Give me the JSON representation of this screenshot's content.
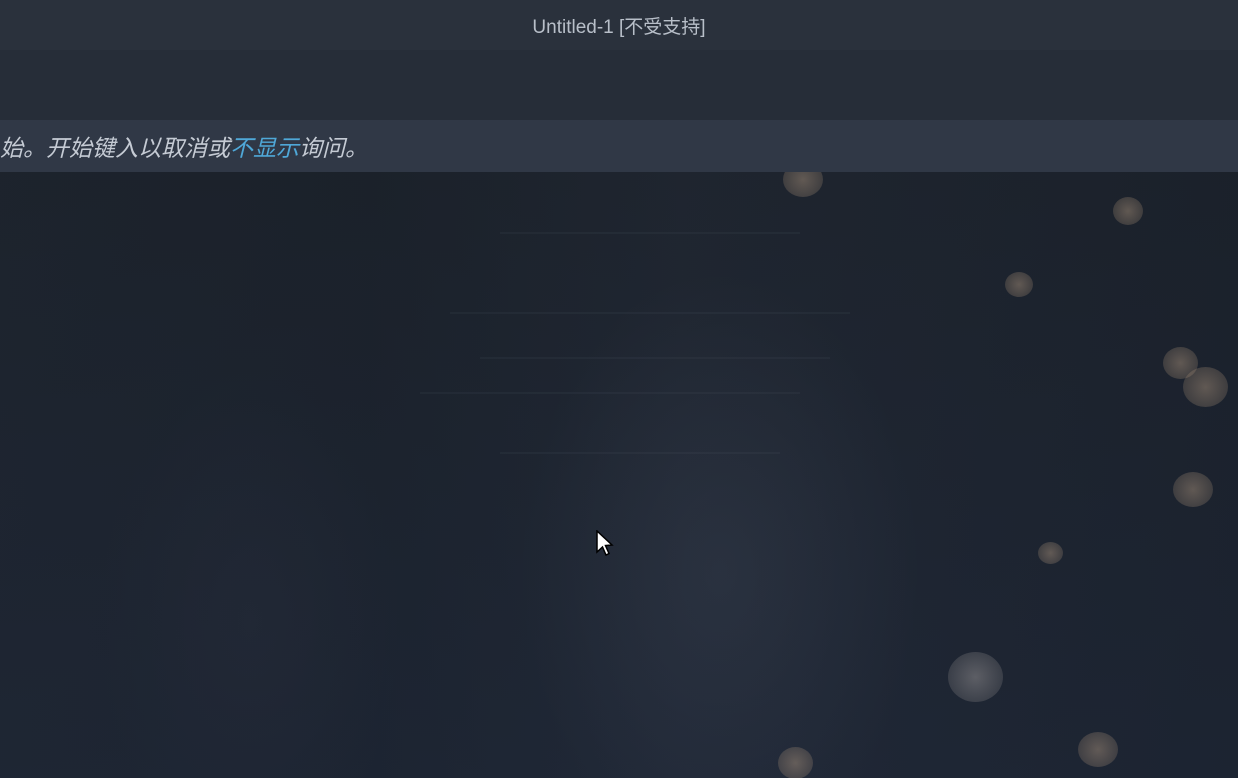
{
  "titleBar": {
    "title": "Untitled-1 [不受支持]"
  },
  "notification": {
    "textPrefix": "始。开始键入以取消或",
    "linkText": "不显示",
    "textSuffix": "询问。"
  }
}
